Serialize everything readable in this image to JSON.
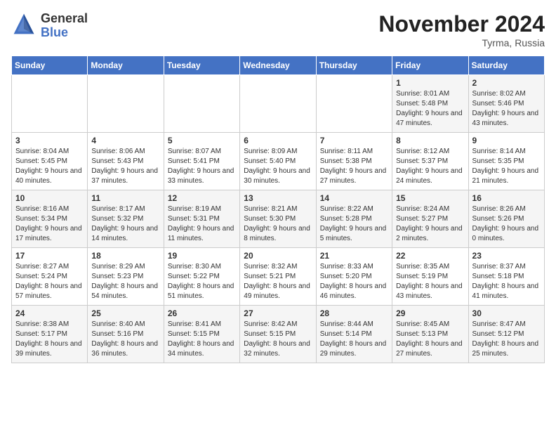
{
  "header": {
    "logo_general": "General",
    "logo_blue": "Blue",
    "month": "November 2024",
    "location": "Tyrma, Russia"
  },
  "days_of_week": [
    "Sunday",
    "Monday",
    "Tuesday",
    "Wednesday",
    "Thursday",
    "Friday",
    "Saturday"
  ],
  "weeks": [
    [
      {
        "day": "",
        "sunrise": "",
        "sunset": "",
        "daylight": ""
      },
      {
        "day": "",
        "sunrise": "",
        "sunset": "",
        "daylight": ""
      },
      {
        "day": "",
        "sunrise": "",
        "sunset": "",
        "daylight": ""
      },
      {
        "day": "",
        "sunrise": "",
        "sunset": "",
        "daylight": ""
      },
      {
        "day": "",
        "sunrise": "",
        "sunset": "",
        "daylight": ""
      },
      {
        "day": "1",
        "sunrise": "Sunrise: 8:01 AM",
        "sunset": "Sunset: 5:48 PM",
        "daylight": "Daylight: 9 hours and 47 minutes."
      },
      {
        "day": "2",
        "sunrise": "Sunrise: 8:02 AM",
        "sunset": "Sunset: 5:46 PM",
        "daylight": "Daylight: 9 hours and 43 minutes."
      }
    ],
    [
      {
        "day": "3",
        "sunrise": "Sunrise: 8:04 AM",
        "sunset": "Sunset: 5:45 PM",
        "daylight": "Daylight: 9 hours and 40 minutes."
      },
      {
        "day": "4",
        "sunrise": "Sunrise: 8:06 AM",
        "sunset": "Sunset: 5:43 PM",
        "daylight": "Daylight: 9 hours and 37 minutes."
      },
      {
        "day": "5",
        "sunrise": "Sunrise: 8:07 AM",
        "sunset": "Sunset: 5:41 PM",
        "daylight": "Daylight: 9 hours and 33 minutes."
      },
      {
        "day": "6",
        "sunrise": "Sunrise: 8:09 AM",
        "sunset": "Sunset: 5:40 PM",
        "daylight": "Daylight: 9 hours and 30 minutes."
      },
      {
        "day": "7",
        "sunrise": "Sunrise: 8:11 AM",
        "sunset": "Sunset: 5:38 PM",
        "daylight": "Daylight: 9 hours and 27 minutes."
      },
      {
        "day": "8",
        "sunrise": "Sunrise: 8:12 AM",
        "sunset": "Sunset: 5:37 PM",
        "daylight": "Daylight: 9 hours and 24 minutes."
      },
      {
        "day": "9",
        "sunrise": "Sunrise: 8:14 AM",
        "sunset": "Sunset: 5:35 PM",
        "daylight": "Daylight: 9 hours and 21 minutes."
      }
    ],
    [
      {
        "day": "10",
        "sunrise": "Sunrise: 8:16 AM",
        "sunset": "Sunset: 5:34 PM",
        "daylight": "Daylight: 9 hours and 17 minutes."
      },
      {
        "day": "11",
        "sunrise": "Sunrise: 8:17 AM",
        "sunset": "Sunset: 5:32 PM",
        "daylight": "Daylight: 9 hours and 14 minutes."
      },
      {
        "day": "12",
        "sunrise": "Sunrise: 8:19 AM",
        "sunset": "Sunset: 5:31 PM",
        "daylight": "Daylight: 9 hours and 11 minutes."
      },
      {
        "day": "13",
        "sunrise": "Sunrise: 8:21 AM",
        "sunset": "Sunset: 5:30 PM",
        "daylight": "Daylight: 9 hours and 8 minutes."
      },
      {
        "day": "14",
        "sunrise": "Sunrise: 8:22 AM",
        "sunset": "Sunset: 5:28 PM",
        "daylight": "Daylight: 9 hours and 5 minutes."
      },
      {
        "day": "15",
        "sunrise": "Sunrise: 8:24 AM",
        "sunset": "Sunset: 5:27 PM",
        "daylight": "Daylight: 9 hours and 2 minutes."
      },
      {
        "day": "16",
        "sunrise": "Sunrise: 8:26 AM",
        "sunset": "Sunset: 5:26 PM",
        "daylight": "Daylight: 9 hours and 0 minutes."
      }
    ],
    [
      {
        "day": "17",
        "sunrise": "Sunrise: 8:27 AM",
        "sunset": "Sunset: 5:24 PM",
        "daylight": "Daylight: 8 hours and 57 minutes."
      },
      {
        "day": "18",
        "sunrise": "Sunrise: 8:29 AM",
        "sunset": "Sunset: 5:23 PM",
        "daylight": "Daylight: 8 hours and 54 minutes."
      },
      {
        "day": "19",
        "sunrise": "Sunrise: 8:30 AM",
        "sunset": "Sunset: 5:22 PM",
        "daylight": "Daylight: 8 hours and 51 minutes."
      },
      {
        "day": "20",
        "sunrise": "Sunrise: 8:32 AM",
        "sunset": "Sunset: 5:21 PM",
        "daylight": "Daylight: 8 hours and 49 minutes."
      },
      {
        "day": "21",
        "sunrise": "Sunrise: 8:33 AM",
        "sunset": "Sunset: 5:20 PM",
        "daylight": "Daylight: 8 hours and 46 minutes."
      },
      {
        "day": "22",
        "sunrise": "Sunrise: 8:35 AM",
        "sunset": "Sunset: 5:19 PM",
        "daylight": "Daylight: 8 hours and 43 minutes."
      },
      {
        "day": "23",
        "sunrise": "Sunrise: 8:37 AM",
        "sunset": "Sunset: 5:18 PM",
        "daylight": "Daylight: 8 hours and 41 minutes."
      }
    ],
    [
      {
        "day": "24",
        "sunrise": "Sunrise: 8:38 AM",
        "sunset": "Sunset: 5:17 PM",
        "daylight": "Daylight: 8 hours and 39 minutes."
      },
      {
        "day": "25",
        "sunrise": "Sunrise: 8:40 AM",
        "sunset": "Sunset: 5:16 PM",
        "daylight": "Daylight: 8 hours and 36 minutes."
      },
      {
        "day": "26",
        "sunrise": "Sunrise: 8:41 AM",
        "sunset": "Sunset: 5:15 PM",
        "daylight": "Daylight: 8 hours and 34 minutes."
      },
      {
        "day": "27",
        "sunrise": "Sunrise: 8:42 AM",
        "sunset": "Sunset: 5:15 PM",
        "daylight": "Daylight: 8 hours and 32 minutes."
      },
      {
        "day": "28",
        "sunrise": "Sunrise: 8:44 AM",
        "sunset": "Sunset: 5:14 PM",
        "daylight": "Daylight: 8 hours and 29 minutes."
      },
      {
        "day": "29",
        "sunrise": "Sunrise: 8:45 AM",
        "sunset": "Sunset: 5:13 PM",
        "daylight": "Daylight: 8 hours and 27 minutes."
      },
      {
        "day": "30",
        "sunrise": "Sunrise: 8:47 AM",
        "sunset": "Sunset: 5:12 PM",
        "daylight": "Daylight: 8 hours and 25 minutes."
      }
    ]
  ]
}
